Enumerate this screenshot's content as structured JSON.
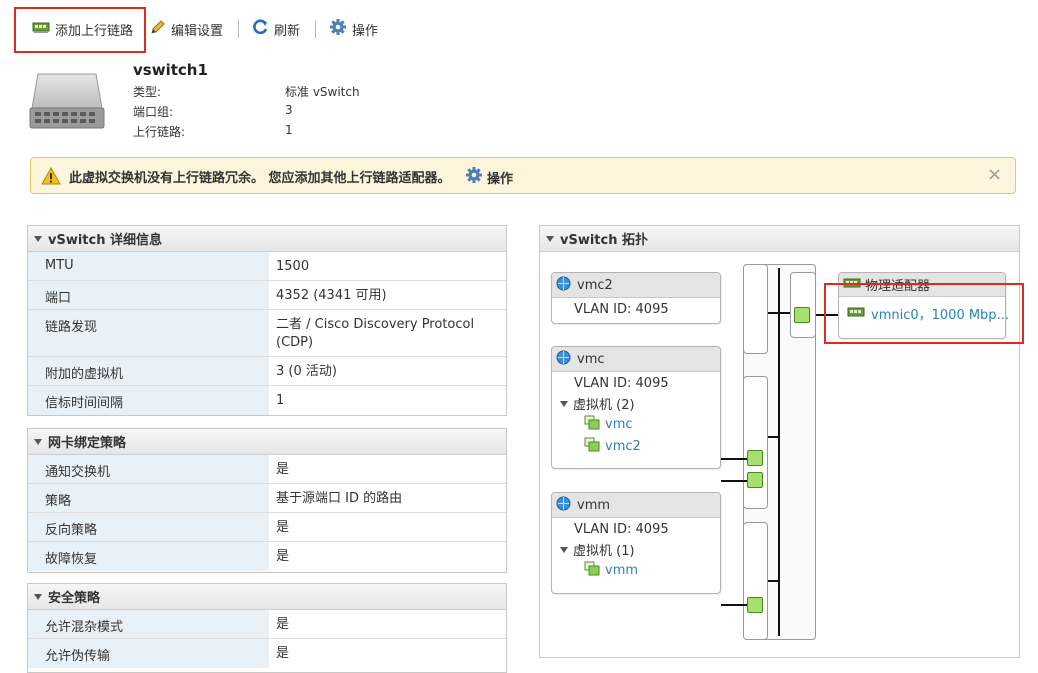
{
  "toolbar": {
    "add_uplink": "添加上行链路",
    "edit_settings": "编辑设置",
    "refresh": "刷新",
    "actions": "操作"
  },
  "header": {
    "name": "vswitch1",
    "rows": [
      {
        "label": "类型:",
        "value": "标准 vSwitch"
      },
      {
        "label": "端口组:",
        "value": "3"
      },
      {
        "label": "上行链路:",
        "value": "1"
      }
    ]
  },
  "warning": {
    "text": "此虚拟交换机没有上行链路冗余。 您应添加其他上行链路适配器。",
    "action": "操作",
    "close": "×"
  },
  "details": {
    "title": "vSwitch 详细信息",
    "rows": [
      {
        "label": "MTU",
        "value": "1500"
      },
      {
        "label": "端口",
        "value": "4352 (4341 可用)"
      },
      {
        "label": "链路发现",
        "value": "二者 / Cisco Discovery Protocol (CDP)"
      },
      {
        "label": "附加的虚拟机",
        "value": "3 (0 活动)"
      },
      {
        "label": "信标时间间隔",
        "value": "1"
      }
    ]
  },
  "nic_teaming": {
    "title": "网卡绑定策略",
    "rows": [
      {
        "label": "通知交换机",
        "value": "是"
      },
      {
        "label": "策略",
        "value": "基于源端口 ID 的路由"
      },
      {
        "label": "反向策略",
        "value": "是"
      },
      {
        "label": "故障恢复",
        "value": "是"
      }
    ]
  },
  "security": {
    "title": "安全策略",
    "rows": [
      {
        "label": "允许混杂模式",
        "value": "是"
      },
      {
        "label": "允许伪传输",
        "value": "是"
      }
    ]
  },
  "topology": {
    "title": "vSwitch 拓扑",
    "portgroups": [
      {
        "name": "vmc2",
        "vlan": "VLAN ID: 4095"
      },
      {
        "name": "vmc",
        "vlan": "VLAN ID: 4095",
        "vm_header": "虚拟机 (2)",
        "vms": [
          "vmc",
          "vmc2"
        ]
      },
      {
        "name": "vmm",
        "vlan": "VLAN ID: 4095",
        "vm_header": "虚拟机 (1)",
        "vms": [
          "vmm"
        ]
      }
    ],
    "physical": {
      "title": "物理适配器",
      "nic": "vmnic0，1000 Mbp..."
    }
  },
  "colors": {
    "highlight": "#e02a20",
    "link": "#2a7fc1",
    "port_green": "#a5e06e",
    "warning_bg": "#fdf6dc"
  }
}
